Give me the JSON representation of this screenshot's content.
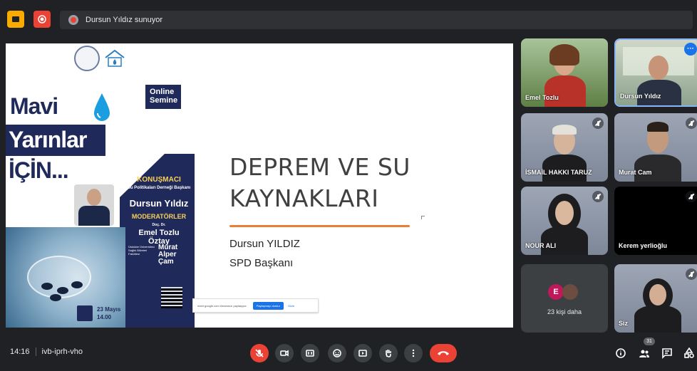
{
  "topbar": {
    "presenting_text": "Dursun Yıldız sunuyor"
  },
  "slide": {
    "title": "DEPREM VE SU\nKAYNAKLARI",
    "author": "Dursun YILDIZ",
    "role": "SPD Başkanı",
    "accent_color": "#ed7d31"
  },
  "poster": {
    "title_line1": "Mavi",
    "title_line2": "Yarınlar",
    "title_line3": "İÇİN...",
    "online_text": "Online Semine",
    "speaker_heading": "KONUŞMACI",
    "speaker_sub": "Su Politikaları Derneği Başkanı",
    "speaker_name": "Dursun Yıldız",
    "moderator_heading": "MODERATÖRLER",
    "moderator_title": "Doç. Dr.",
    "moderator_name1": "Emel Tozlu Öztay",
    "moderator_sub": "Üsküdar Üniversitesi Sağlık Bilimleri Fakültesi",
    "moderator_name2": "Murat Alper Çam",
    "date_text": "23 Mayıs",
    "time_text": "14.00",
    "navy_color": "#1f2a5a"
  },
  "share_strip": {
    "text": "meet.google.com ekranınızı paylaşıyor.",
    "stop_button": "Paylaşmayı durdur",
    "hide_link": "Gizle"
  },
  "participants": [
    {
      "name": "Emel Tozlu",
      "muted": false
    },
    {
      "name": "Dursun Yıldız",
      "muted": false
    },
    {
      "name": "İSMAİL HAKKI TARUZ",
      "muted": true
    },
    {
      "name": "Murat Cam",
      "muted": true
    },
    {
      "name": "NOUR ALI",
      "muted": true
    },
    {
      "name": "Kerem yerlioğlu",
      "muted": true
    },
    {
      "name": "Siz",
      "muted": true
    }
  ],
  "others": {
    "label": "23 kişi daha",
    "avatar_letter": "E"
  },
  "bottombar": {
    "time": "14:16",
    "meeting_code": "ivb-iprh-vho",
    "people_count": "31"
  }
}
